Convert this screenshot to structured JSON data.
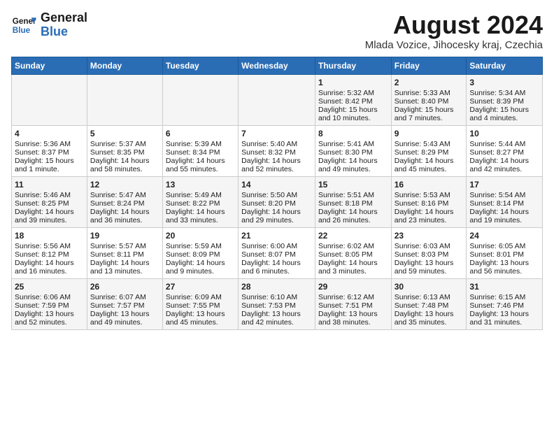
{
  "header": {
    "logo_line1": "General",
    "logo_line2": "Blue",
    "main_title": "August 2024",
    "subtitle": "Mlada Vozice, Jihocesky kraj, Czechia"
  },
  "days_of_week": [
    "Sunday",
    "Monday",
    "Tuesday",
    "Wednesday",
    "Thursday",
    "Friday",
    "Saturday"
  ],
  "weeks": [
    [
      {
        "day": "",
        "content": ""
      },
      {
        "day": "",
        "content": ""
      },
      {
        "day": "",
        "content": ""
      },
      {
        "day": "",
        "content": ""
      },
      {
        "day": "1",
        "content": "Sunrise: 5:32 AM\nSunset: 8:42 PM\nDaylight: 15 hours and 10 minutes."
      },
      {
        "day": "2",
        "content": "Sunrise: 5:33 AM\nSunset: 8:40 PM\nDaylight: 15 hours and 7 minutes."
      },
      {
        "day": "3",
        "content": "Sunrise: 5:34 AM\nSunset: 8:39 PM\nDaylight: 15 hours and 4 minutes."
      }
    ],
    [
      {
        "day": "4",
        "content": "Sunrise: 5:36 AM\nSunset: 8:37 PM\nDaylight: 15 hours and 1 minute."
      },
      {
        "day": "5",
        "content": "Sunrise: 5:37 AM\nSunset: 8:35 PM\nDaylight: 14 hours and 58 minutes."
      },
      {
        "day": "6",
        "content": "Sunrise: 5:39 AM\nSunset: 8:34 PM\nDaylight: 14 hours and 55 minutes."
      },
      {
        "day": "7",
        "content": "Sunrise: 5:40 AM\nSunset: 8:32 PM\nDaylight: 14 hours and 52 minutes."
      },
      {
        "day": "8",
        "content": "Sunrise: 5:41 AM\nSunset: 8:30 PM\nDaylight: 14 hours and 49 minutes."
      },
      {
        "day": "9",
        "content": "Sunrise: 5:43 AM\nSunset: 8:29 PM\nDaylight: 14 hours and 45 minutes."
      },
      {
        "day": "10",
        "content": "Sunrise: 5:44 AM\nSunset: 8:27 PM\nDaylight: 14 hours and 42 minutes."
      }
    ],
    [
      {
        "day": "11",
        "content": "Sunrise: 5:46 AM\nSunset: 8:25 PM\nDaylight: 14 hours and 39 minutes."
      },
      {
        "day": "12",
        "content": "Sunrise: 5:47 AM\nSunset: 8:24 PM\nDaylight: 14 hours and 36 minutes."
      },
      {
        "day": "13",
        "content": "Sunrise: 5:49 AM\nSunset: 8:22 PM\nDaylight: 14 hours and 33 minutes."
      },
      {
        "day": "14",
        "content": "Sunrise: 5:50 AM\nSunset: 8:20 PM\nDaylight: 14 hours and 29 minutes."
      },
      {
        "day": "15",
        "content": "Sunrise: 5:51 AM\nSunset: 8:18 PM\nDaylight: 14 hours and 26 minutes."
      },
      {
        "day": "16",
        "content": "Sunrise: 5:53 AM\nSunset: 8:16 PM\nDaylight: 14 hours and 23 minutes."
      },
      {
        "day": "17",
        "content": "Sunrise: 5:54 AM\nSunset: 8:14 PM\nDaylight: 14 hours and 19 minutes."
      }
    ],
    [
      {
        "day": "18",
        "content": "Sunrise: 5:56 AM\nSunset: 8:12 PM\nDaylight: 14 hours and 16 minutes."
      },
      {
        "day": "19",
        "content": "Sunrise: 5:57 AM\nSunset: 8:11 PM\nDaylight: 14 hours and 13 minutes."
      },
      {
        "day": "20",
        "content": "Sunrise: 5:59 AM\nSunset: 8:09 PM\nDaylight: 14 hours and 9 minutes."
      },
      {
        "day": "21",
        "content": "Sunrise: 6:00 AM\nSunset: 8:07 PM\nDaylight: 14 hours and 6 minutes."
      },
      {
        "day": "22",
        "content": "Sunrise: 6:02 AM\nSunset: 8:05 PM\nDaylight: 14 hours and 3 minutes."
      },
      {
        "day": "23",
        "content": "Sunrise: 6:03 AM\nSunset: 8:03 PM\nDaylight: 13 hours and 59 minutes."
      },
      {
        "day": "24",
        "content": "Sunrise: 6:05 AM\nSunset: 8:01 PM\nDaylight: 13 hours and 56 minutes."
      }
    ],
    [
      {
        "day": "25",
        "content": "Sunrise: 6:06 AM\nSunset: 7:59 PM\nDaylight: 13 hours and 52 minutes."
      },
      {
        "day": "26",
        "content": "Sunrise: 6:07 AM\nSunset: 7:57 PM\nDaylight: 13 hours and 49 minutes."
      },
      {
        "day": "27",
        "content": "Sunrise: 6:09 AM\nSunset: 7:55 PM\nDaylight: 13 hours and 45 minutes."
      },
      {
        "day": "28",
        "content": "Sunrise: 6:10 AM\nSunset: 7:53 PM\nDaylight: 13 hours and 42 minutes."
      },
      {
        "day": "29",
        "content": "Sunrise: 6:12 AM\nSunset: 7:51 PM\nDaylight: 13 hours and 38 minutes."
      },
      {
        "day": "30",
        "content": "Sunrise: 6:13 AM\nSunset: 7:48 PM\nDaylight: 13 hours and 35 minutes."
      },
      {
        "day": "31",
        "content": "Sunrise: 6:15 AM\nSunset: 7:46 PM\nDaylight: 13 hours and 31 minutes."
      }
    ]
  ]
}
